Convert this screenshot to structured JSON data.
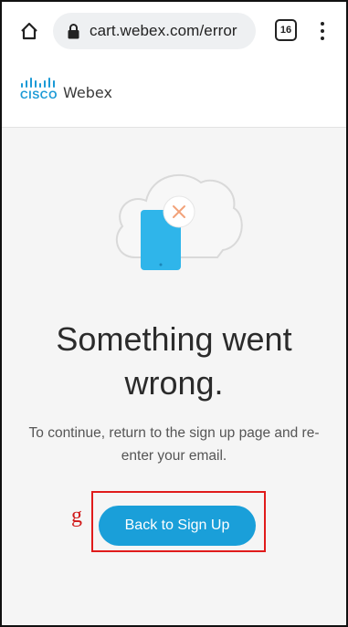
{
  "browser": {
    "url": "cart.webex.com/error",
    "tab_count": "16"
  },
  "header": {
    "logo_cisco": "CISCO",
    "logo_webex": "Webex"
  },
  "main": {
    "title": "Something went wrong.",
    "message": "To continue, return to the sign up page and re-enter your email.",
    "back_button_label": "Back to Sign Up",
    "annotation_label": "g"
  },
  "colors": {
    "accent": "#1a9fd9",
    "annotation": "#e01b1b",
    "error_x": "#f2a27a"
  },
  "icons": [
    "home-icon",
    "lock-icon",
    "tabs-icon",
    "more-vert-icon",
    "cloud-icon",
    "phone-icon",
    "error-x-icon"
  ]
}
